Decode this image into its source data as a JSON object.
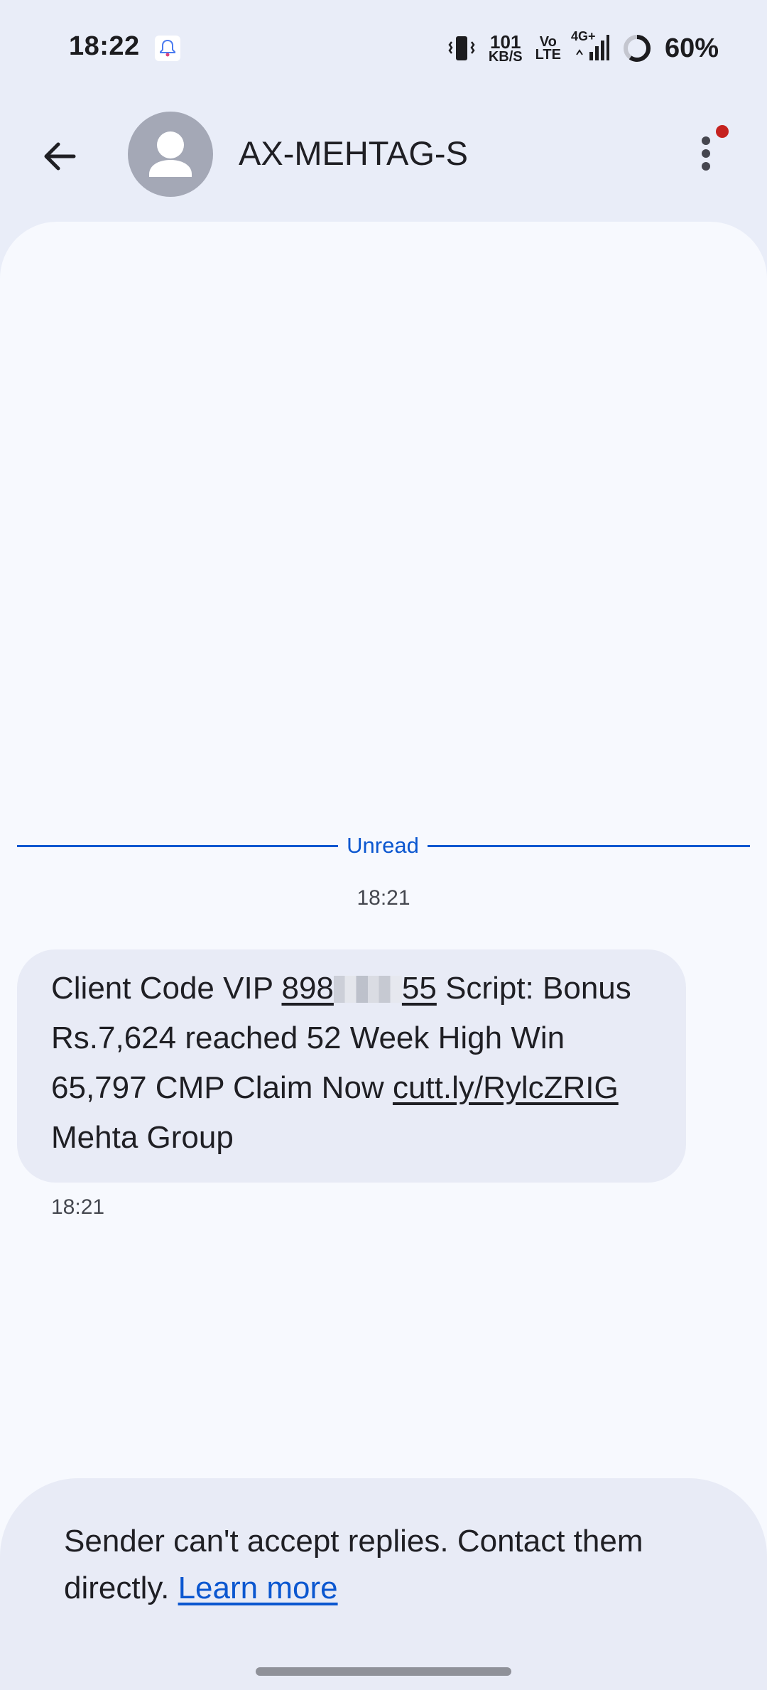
{
  "status_bar": {
    "time": "18:22",
    "speed_top": "101",
    "speed_bottom": "KB/S",
    "volte_top": "Vo",
    "volte_bottom": "LTE",
    "network": "4G+",
    "battery_percent": "60%",
    "battery_level": 0.6
  },
  "header": {
    "contact_name": "AX-MEHTAG-S",
    "menu_has_badge": true
  },
  "conversation": {
    "unread_label": "Unread",
    "group_time": "18:21",
    "message": {
      "client_code_prefix": "Client Code VIP ",
      "client_code_start": "898",
      "client_code_end": "55",
      "after_code": " Script: Bonus Rs.7,624 reached 52 Week High Win 65,797 CMP Claim Now ",
      "link_text": "cutt.ly/RylcZRIG",
      "suffix": " Mehta Group",
      "time": "18:21"
    }
  },
  "footer": {
    "notice_text": "Sender can't accept replies. Contact them directly. ",
    "learn_more": "Learn more"
  },
  "colors": {
    "accent": "#0b57d0",
    "background": "#e9edf8",
    "conversation_bg": "#f7f9fe",
    "bubble_bg": "#e8ebf6",
    "badge": "#c5221f"
  }
}
